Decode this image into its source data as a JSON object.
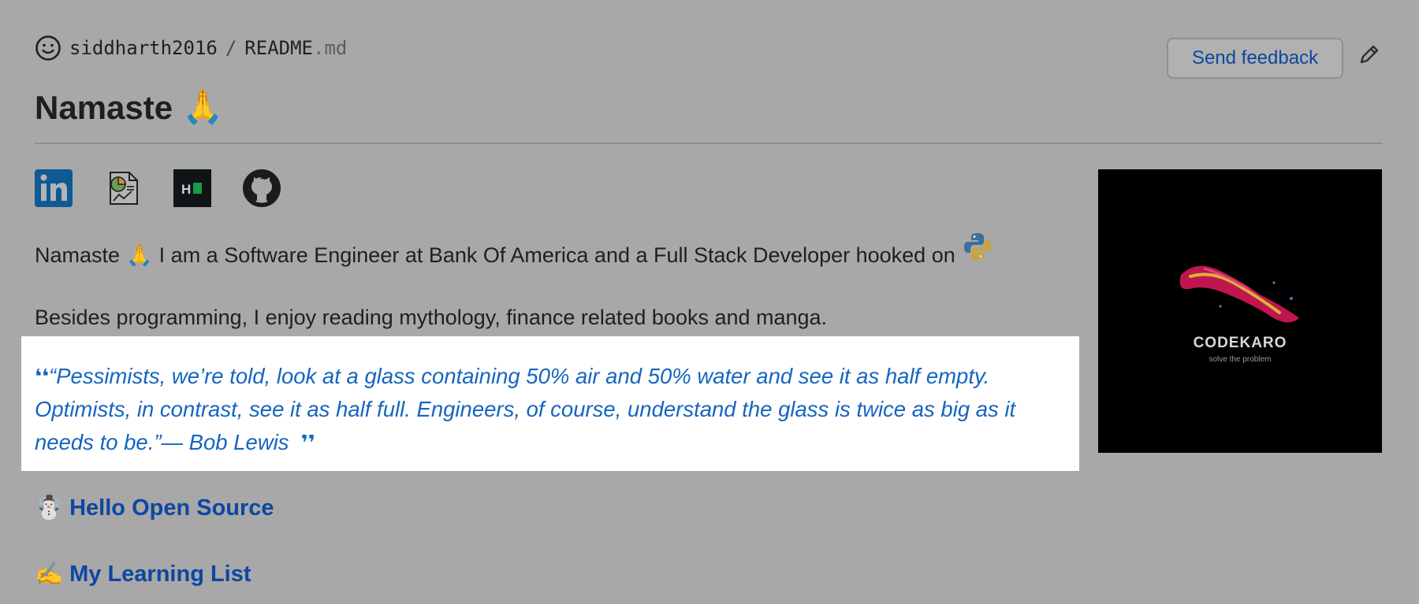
{
  "header": {
    "owner": "siddharth2016",
    "separator": "/",
    "file_name": "README",
    "file_ext": ".md",
    "feedback_label": "Send feedback"
  },
  "readme": {
    "title": "Namaste",
    "title_emoji": "🙏",
    "intro_start": "Namaste",
    "intro_emoji": "🙏",
    "intro_text": "I am a Software Engineer at Bank Of America and a Full Stack Developer hooked on",
    "besides": "Besides programming, I enjoy reading mythology, finance related books and manga.",
    "quote_open": "❛❛",
    "quote_text": "“Pessimists, we’re told, look at a glass containing 50% air and 50% water and see it as half empty. Optimists, in contrast, see it as half full. Engineers, of course, understand the glass is twice as big as it needs to be.”— Bob Lewis",
    "quote_close": "❜❜",
    "logo_word": "CODEKARO",
    "logo_sub": "solve the problem",
    "sections": [
      {
        "emoji": "☃️",
        "label": "Hello Open Source"
      },
      {
        "emoji": "✍️",
        "label": "My Learning List"
      }
    ]
  },
  "icons": {
    "smiley": "smiley-icon",
    "edit": "pencil-icon",
    "social": [
      "linkedin-icon",
      "portfolio-icon",
      "hackerrank-icon",
      "github-icon"
    ],
    "python": "python-icon"
  },
  "colors": {
    "link": "#0d47a1",
    "quote": "#1565c0",
    "overlay_bg": "#a8a8a8"
  }
}
